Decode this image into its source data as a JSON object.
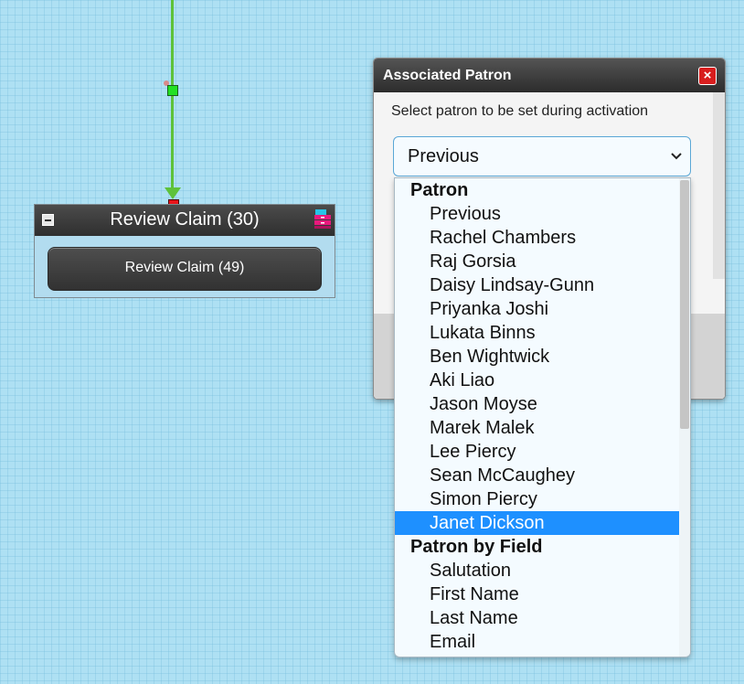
{
  "node": {
    "title": "Review Claim (30)",
    "button_label": "Review Claim (49)"
  },
  "dialog": {
    "title": "Associated Patron",
    "close_label": "×",
    "instructions": "Select patron to be set during activation"
  },
  "select": {
    "current_value": "Previous"
  },
  "dropdown": {
    "groups": [
      {
        "label": "Patron",
        "options": [
          "Previous",
          "Rachel Chambers",
          "Raj Gorsia",
          "Daisy Lindsay-Gunn",
          "Priyanka Joshi",
          "Lukata Binns",
          "Ben Wightwick",
          "Aki Liao",
          "Jason Moyse",
          "Marek Malek",
          "Lee Piercy",
          "Sean McCaughey",
          "Simon Piercy",
          "Janet Dickson"
        ]
      },
      {
        "label": "Patron by Field",
        "options": [
          "Salutation",
          "First Name",
          "Last Name",
          "Email"
        ]
      }
    ],
    "highlighted": "Janet Dickson"
  },
  "colors": {
    "canvas": "#aee0f3",
    "connector": "#5ec23a",
    "highlight": "#1e90ff",
    "close_button": "#d81e1e"
  },
  "icons": {
    "collapse": "collapse-icon",
    "stack": "stack-icon",
    "close": "close-icon",
    "chevron": "chevron-down-icon"
  }
}
